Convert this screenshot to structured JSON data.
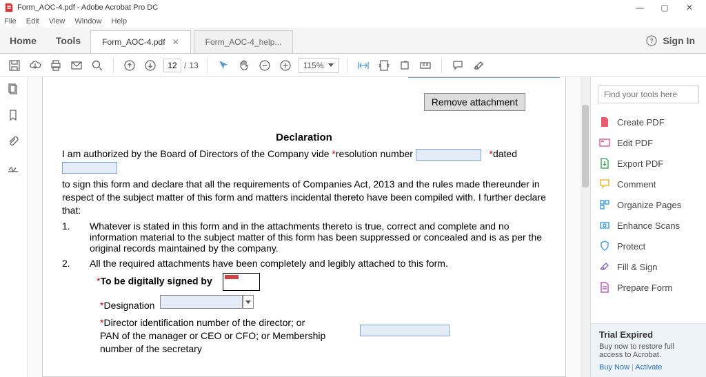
{
  "app": {
    "title": "Form_AOC-4.pdf - Adobe Acrobat Pro DC",
    "menus": [
      "File",
      "Edit",
      "View",
      "Window",
      "Help"
    ],
    "home": "Home",
    "tools": "Tools",
    "signin": "Sign In"
  },
  "tabs": [
    {
      "label": "Form_AOC-4.pdf",
      "active": true
    },
    {
      "label": "Form_AOC-4_help...",
      "active": false
    }
  ],
  "toolbar": {
    "page_current": "12",
    "page_total": "13",
    "zoom": "115%"
  },
  "right_panel": {
    "search_placeholder": "Find your tools here",
    "items": [
      {
        "icon": "create-pdf",
        "label": "Create PDF",
        "color": "#e85d6b"
      },
      {
        "icon": "edit-pdf",
        "label": "Edit PDF",
        "color": "#e85d9d"
      },
      {
        "icon": "export-pdf",
        "label": "Export PDF",
        "color": "#4aa564"
      },
      {
        "icon": "comment",
        "label": "Comment",
        "color": "#f0b73a"
      },
      {
        "icon": "organize",
        "label": "Organize Pages",
        "color": "#4aa3df"
      },
      {
        "icon": "enhance",
        "label": "Enhance Scans",
        "color": "#4aa3df"
      },
      {
        "icon": "protect",
        "label": "Protect",
        "color": "#4aa3df"
      },
      {
        "icon": "fillsign",
        "label": "Fill & Sign",
        "color": "#8c6fc9"
      },
      {
        "icon": "prepare",
        "label": "Prepare Form",
        "color": "#c05dc4"
      }
    ],
    "trial": {
      "title": "Trial Expired",
      "text": "Buy now to restore full access to Acrobat.",
      "buy": "Buy Now",
      "activate": "Activate"
    }
  },
  "document": {
    "remove_attachment": "Remove attachment",
    "decl_title": "Declaration",
    "line1a": "I am authorized by the Board of Directors of the Company vide ",
    "line1b": "resolution number ",
    "line1c": "dated ",
    "line2": "to sign this form and declare that all the requirements of Companies Act, 2013 and the rules made thereunder in respect of the subject matter of this form and matters incidental thereto have been compiled with. I further declare that:",
    "item1_num": "1.",
    "item1": "Whatever is stated in this form and in the attachments thereto is true, correct and complete and no information material to the subject matter of this form has been suppressed or concealed and is as per the original records maintained by the company.",
    "item2_num": "2.",
    "item2": "All the required attachments have been completely and legibly attached to this form.",
    "signed_by": "To be digitally signed by",
    "designation": "Designation",
    "din_line1": "Director identification number of the director; or",
    "din_line2": "PAN of the manager or CEO or CFO; or Membership",
    "din_line3": "number of the secretary"
  }
}
